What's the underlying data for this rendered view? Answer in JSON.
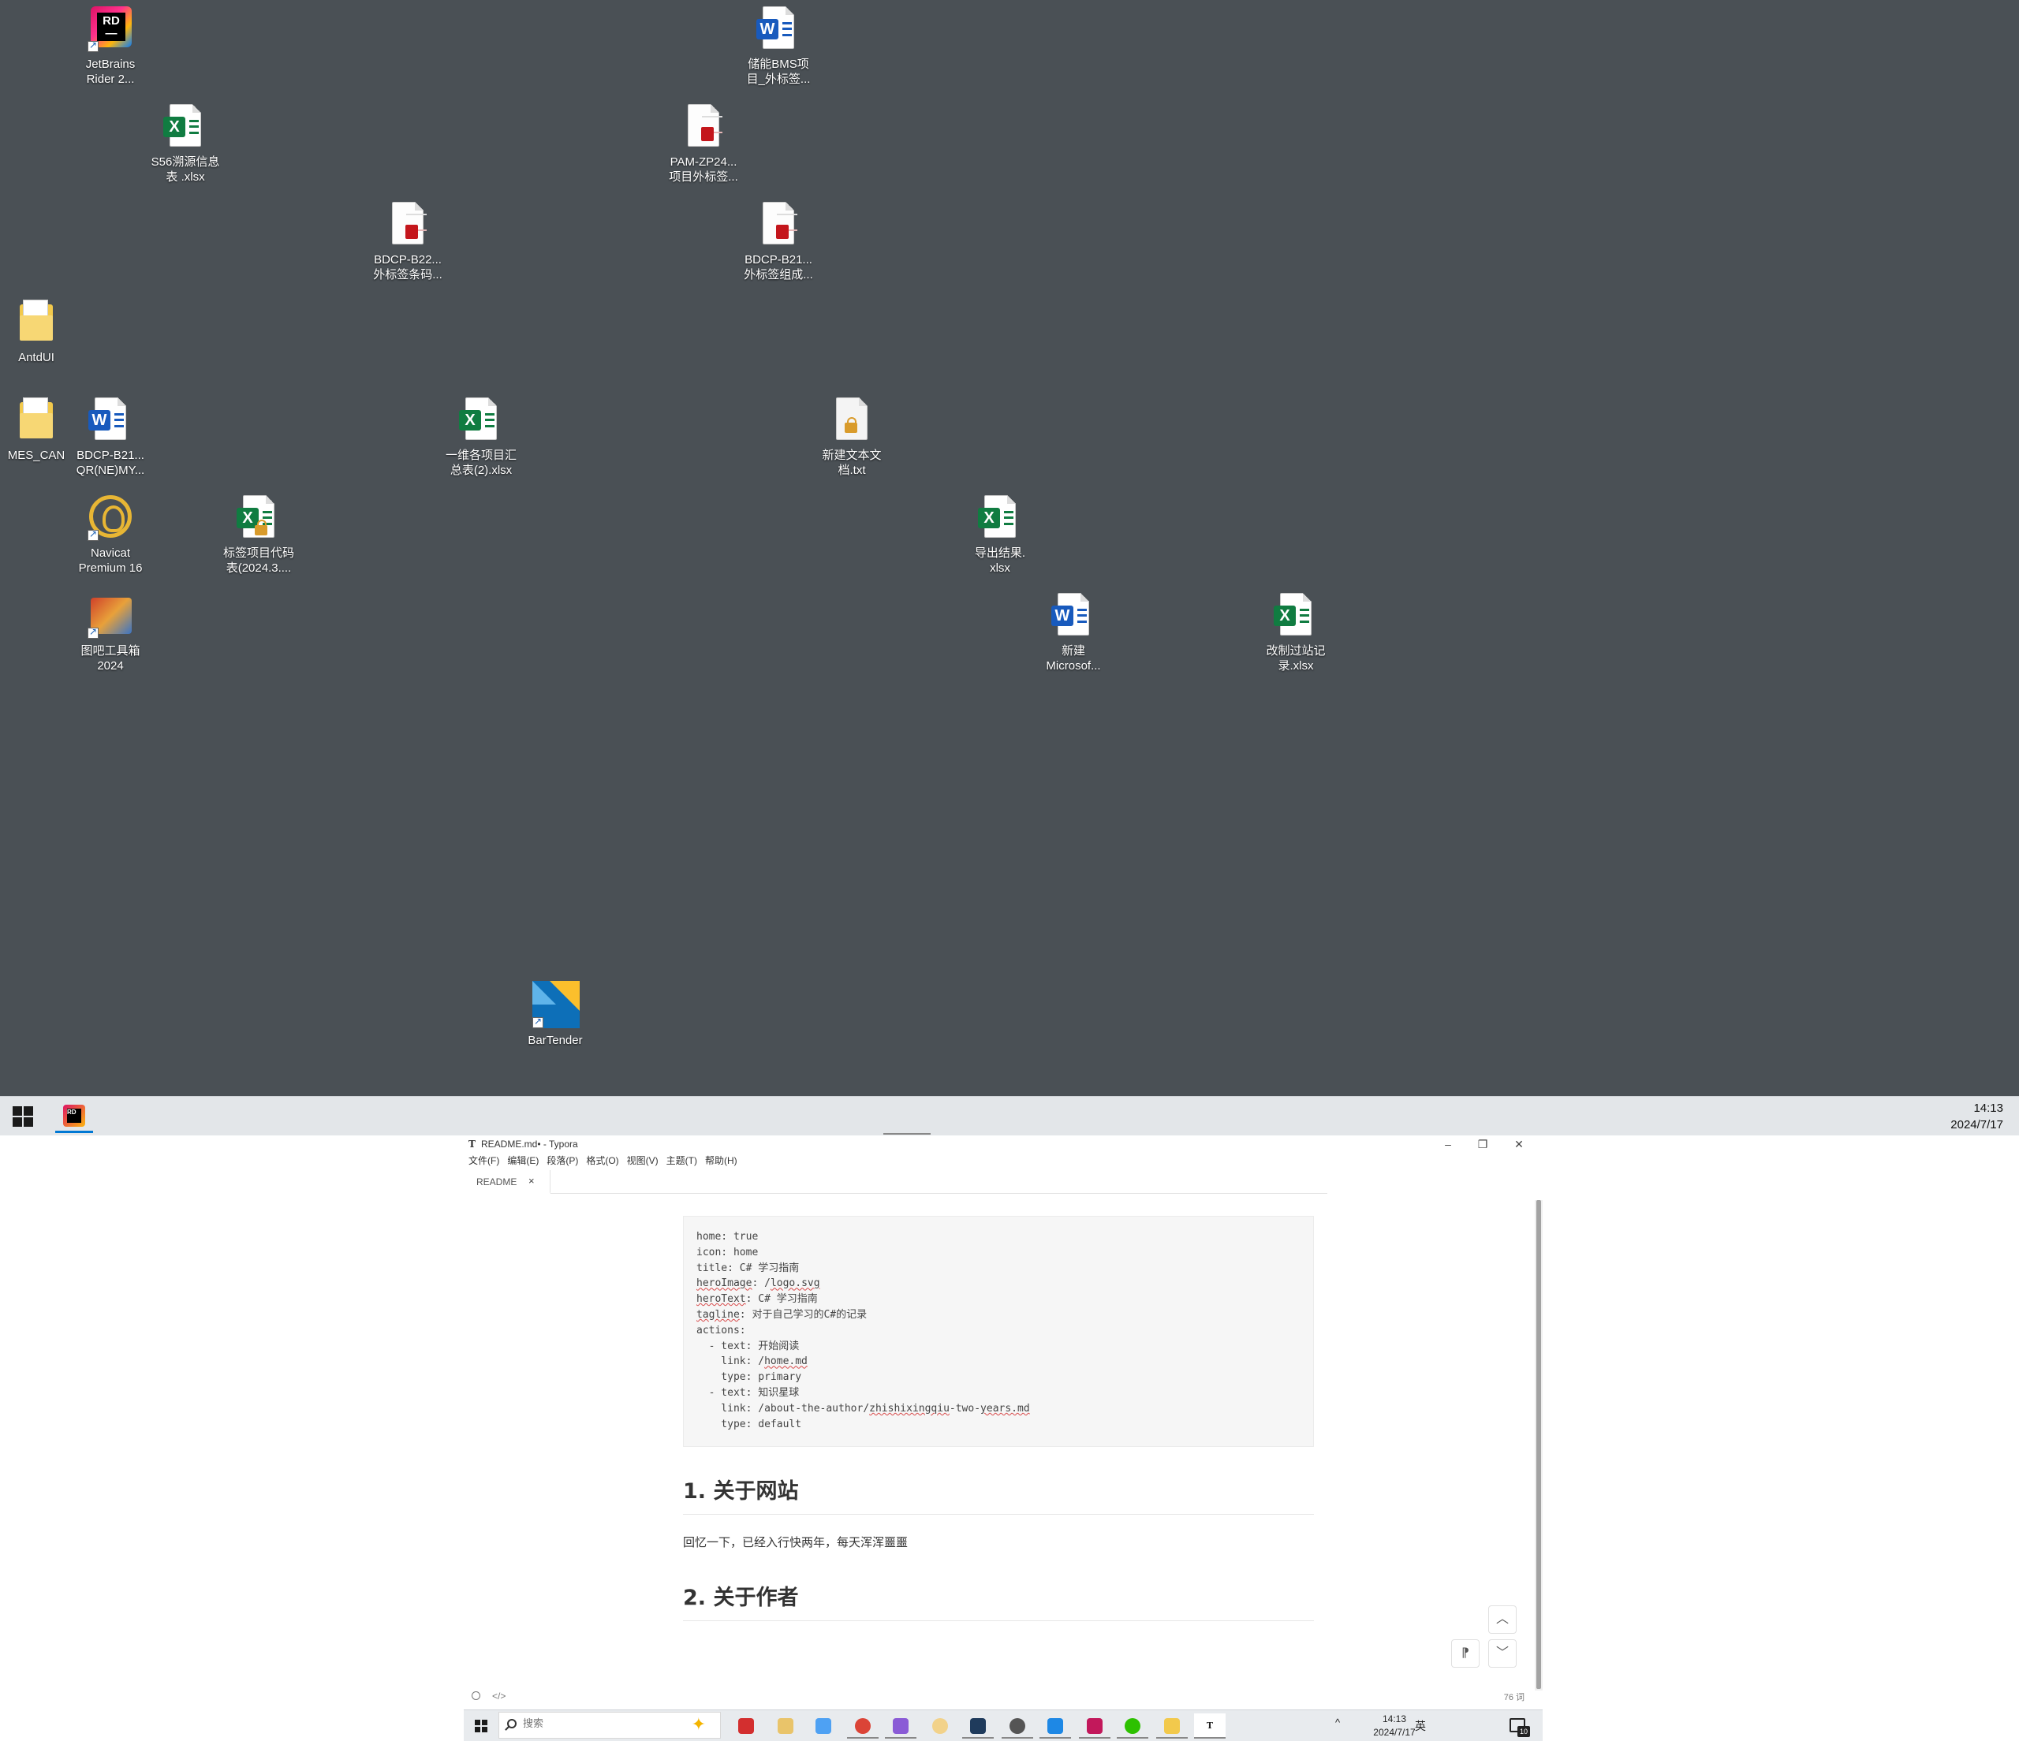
{
  "desktop": {
    "background": "#4a5055",
    "icons": [
      {
        "label": "JetBrains\nRider 2...",
        "icon": "rider-icon"
      },
      {
        "label": "储能BMS项\n目_外标签...",
        "icon": "word-doc-icon"
      },
      {
        "label": "S56溯源信息\n表 .xlsx",
        "icon": "excel-doc-icon"
      },
      {
        "label": "PAM-ZP24...\n项目外标签...",
        "icon": "pdf-thumbnail-icon"
      },
      {
        "label": "BDCP-B22...\n外标签条码...",
        "icon": "pdf-thumbnail-icon"
      },
      {
        "label": "BDCP-B21...\n外标签组成...",
        "icon": "pdf-thumbnail-icon"
      },
      {
        "label": "AntdUI",
        "icon": "folder-icon"
      },
      {
        "label": "MES_CAN",
        "icon": "folder-icon"
      },
      {
        "label": "BDCP-B21...\nQR(NE)MY...",
        "icon": "word-doc-icon"
      },
      {
        "label": "一维各项目汇\n总表(2).xlsx",
        "icon": "excel-doc-icon"
      },
      {
        "label": "新建文本文\n档.txt",
        "icon": "text-file-icon"
      },
      {
        "label": "Navicat\nPremium 16",
        "icon": "navicat-icon"
      },
      {
        "label": "标签项目代码\n表(2024.3....",
        "icon": "excel-doc-icon"
      },
      {
        "label": "导出结果.\nxlsx",
        "icon": "excel-doc-icon"
      },
      {
        "label": "图吧工具箱\n2024",
        "icon": "toolbox-icon"
      },
      {
        "label": "新建\nMicrosof...",
        "icon": "word-doc-icon"
      },
      {
        "label": "改制过站记\n录.xlsx",
        "icon": "excel-doc-icon"
      },
      {
        "label": "BarTender",
        "icon": "bartender-icon"
      }
    ]
  },
  "top_taskbar": {
    "time": "14:13",
    "date": "2024/7/17"
  },
  "typora": {
    "title": "README.md• - Typora",
    "title_icon": "T",
    "menu": [
      "文件(F)",
      "编辑(E)",
      "段落(P)",
      "格式(O)",
      "视图(V)",
      "主题(T)",
      "帮助(H)"
    ],
    "tab_label": "README",
    "tab_close": "×",
    "window_controls": {
      "minimize": "–",
      "restore": "❐",
      "close": "✕"
    },
    "code_lines": [
      [
        {
          "t": "home: true"
        }
      ],
      [
        {
          "t": "icon: home"
        }
      ],
      [
        {
          "t": "title: C# 学习指南"
        }
      ],
      [
        {
          "t": "heroImage",
          "sq": true
        },
        {
          "t": ": /"
        },
        {
          "t": "logo.svg",
          "sq": true
        }
      ],
      [
        {
          "t": "heroText",
          "sq": true
        },
        {
          "t": ": C# 学习指南"
        }
      ],
      [
        {
          "t": "tagline",
          "sq": true
        },
        {
          "t": ": 对于自己学习的C#的记录"
        }
      ],
      [
        {
          "t": "actions:"
        }
      ],
      [
        {
          "t": "  - text: 开始阅读"
        }
      ],
      [
        {
          "t": "    link: /"
        },
        {
          "t": "home.md",
          "sq": true
        }
      ],
      [
        {
          "t": "    type: primary"
        }
      ],
      [
        {
          "t": "  - text: 知识星球"
        }
      ],
      [
        {
          "t": "    link: /about-the-author/"
        },
        {
          "t": "zhishixingqiu",
          "sq": true
        },
        {
          "t": "-two-"
        },
        {
          "t": "years.md",
          "sq": true
        }
      ],
      [
        {
          "t": "    type: default"
        }
      ]
    ],
    "heading1": "1. 关于网站",
    "paragraph1": "回忆一下，已经入行快两年，每天浑浑噩噩",
    "heading2": "2. 关于作者",
    "word_count": "76 词",
    "source_mode_label": "</>",
    "nav_up": "︿",
    "nav_down": "﹀",
    "outline_btn": "⁋"
  },
  "bottom_taskbar": {
    "search_placeholder": "搜索",
    "ime": "英",
    "time": "14:13",
    "date": "2024/7/17",
    "notification_count": "10",
    "tray_glyphs": "^"
  }
}
